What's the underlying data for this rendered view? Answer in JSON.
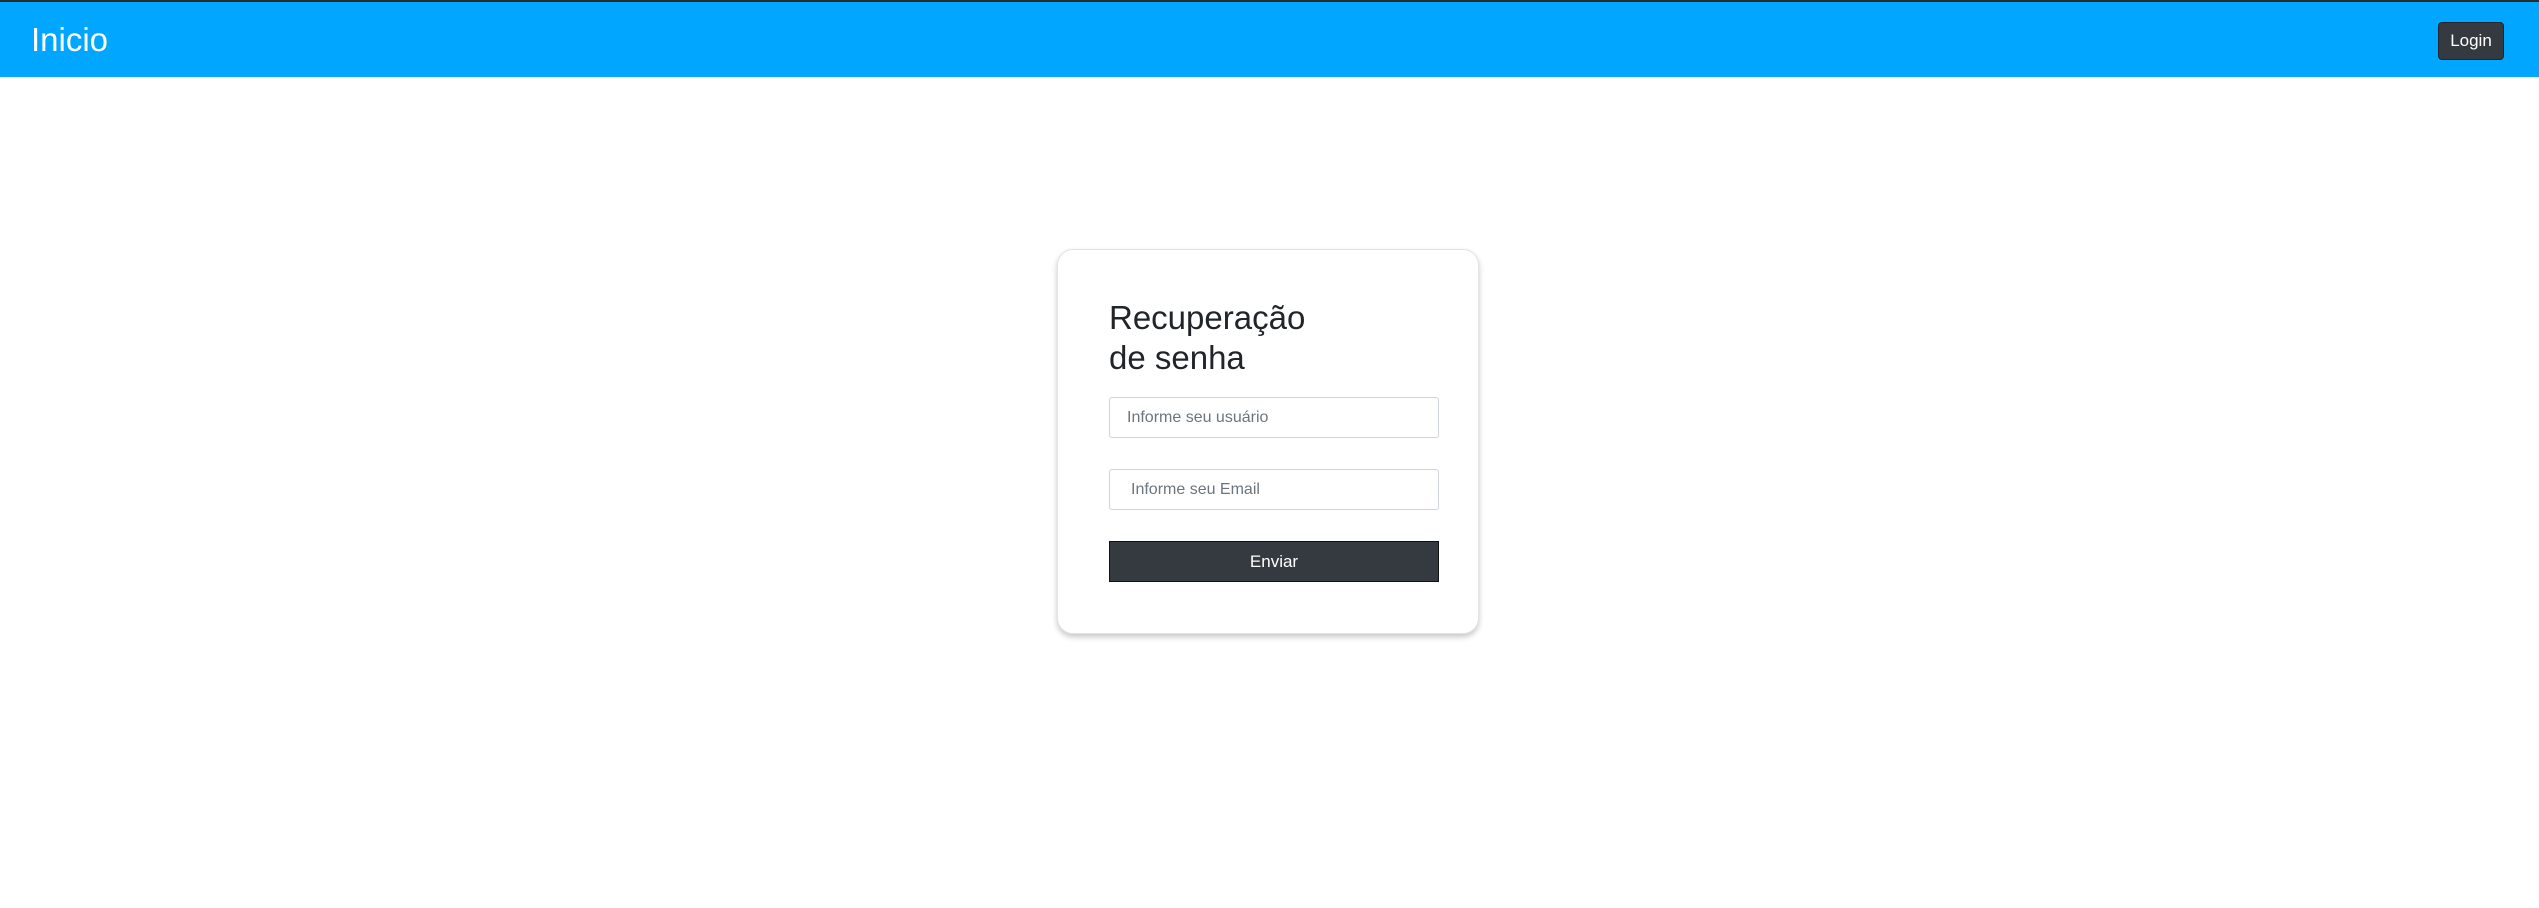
{
  "navbar": {
    "brand": "Inicio",
    "login_label": "Login"
  },
  "card": {
    "title": "Recuperação de senha",
    "user_placeholder": "Informe seu usuário",
    "email_placeholder": "Informe seu Email",
    "submit_label": "Enviar"
  },
  "colors": {
    "navbar": "#00a6ff",
    "dark_button": "#343a40"
  }
}
